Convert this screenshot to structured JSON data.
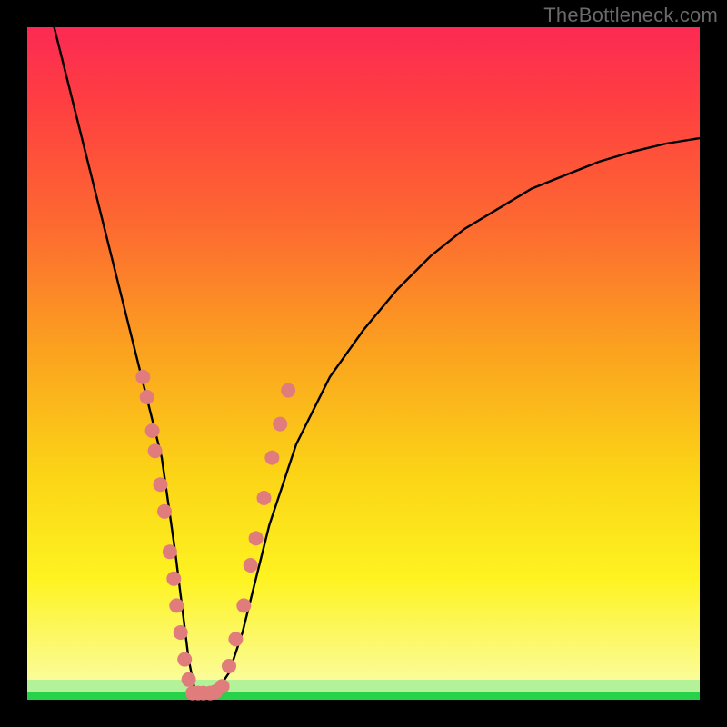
{
  "watermark": "TheBottleneck.com",
  "chart_data": {
    "type": "line",
    "title": "",
    "xlabel": "",
    "ylabel": "",
    "xlim": [
      0,
      100
    ],
    "ylim": [
      0,
      100
    ],
    "grid": false,
    "legend": false,
    "series": [
      {
        "name": "bottleneck-curve",
        "color": "#000000",
        "x": [
          4,
          6,
          8,
          10,
          12,
          14,
          16,
          18,
          20,
          22,
          23,
          24,
          25,
          26,
          28,
          30,
          32,
          34,
          36,
          38,
          40,
          45,
          50,
          55,
          60,
          65,
          70,
          75,
          80,
          85,
          90,
          95,
          100
        ],
        "y": [
          100,
          92,
          84,
          76,
          68,
          60,
          52,
          44,
          36,
          22,
          14,
          6,
          1,
          1,
          1,
          4,
          10,
          18,
          26,
          32,
          38,
          48,
          55,
          61,
          66,
          70,
          73,
          76,
          78,
          80,
          81.5,
          82.7,
          83.5
        ]
      }
    ],
    "markers": [
      {
        "name": "left-branch-markers",
        "color": "#e17c7c",
        "points_xy": [
          [
            17.2,
            48
          ],
          [
            17.8,
            45
          ],
          [
            18.6,
            40
          ],
          [
            19.0,
            37
          ],
          [
            19.8,
            32
          ],
          [
            20.4,
            28
          ],
          [
            21.2,
            22
          ],
          [
            21.8,
            18
          ],
          [
            22.2,
            14
          ],
          [
            22.8,
            10
          ],
          [
            23.4,
            6
          ],
          [
            24.0,
            3
          ]
        ]
      },
      {
        "name": "bottom-markers",
        "color": "#e17c7c",
        "points_xy": [
          [
            24.6,
            1
          ],
          [
            25.4,
            1
          ],
          [
            26.2,
            1
          ],
          [
            27.2,
            1
          ],
          [
            28.0,
            1.2
          ],
          [
            29.0,
            2
          ]
        ]
      },
      {
        "name": "right-branch-markers",
        "color": "#e17c7c",
        "points_xy": [
          [
            30.0,
            5
          ],
          [
            31.0,
            9
          ],
          [
            32.2,
            14
          ],
          [
            33.2,
            20
          ],
          [
            34.0,
            24
          ],
          [
            35.2,
            30
          ],
          [
            36.4,
            36
          ],
          [
            37.6,
            41
          ],
          [
            38.8,
            46
          ]
        ]
      }
    ]
  }
}
